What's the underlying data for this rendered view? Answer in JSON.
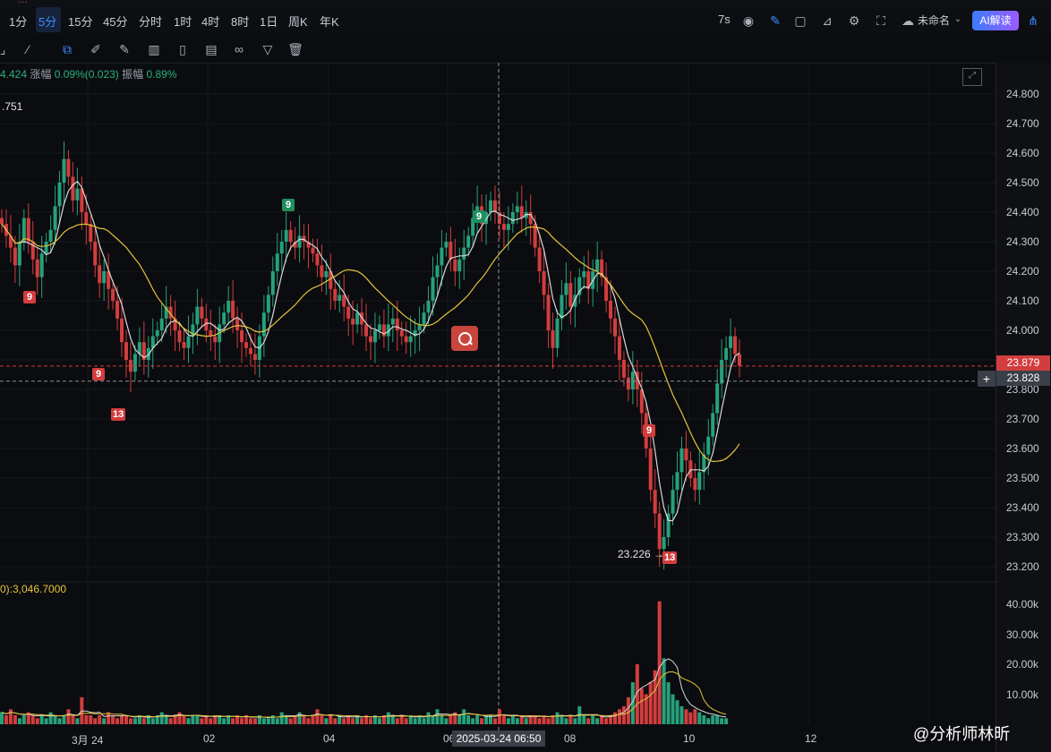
{
  "timeframes": [
    "1分",
    "5分",
    "15分",
    "45分",
    "分时",
    "1时",
    "4时",
    "8时",
    "1日",
    "周K",
    "年K"
  ],
  "active_timeframe": "5分",
  "toolbar_right": {
    "interval": "7s",
    "layout_name": "未命名",
    "ai_label": "AI解读"
  },
  "info_line": {
    "price": "4.424",
    "change_label": "涨幅",
    "change": "0.09%(0.023)",
    "amp_label": "振幅",
    "amplitude": "0.89%"
  },
  "ma_value": ".751",
  "volume_label": "0):3,046.7000",
  "y_axis": [
    "24.800",
    "24.700",
    "24.600",
    "24.500",
    "24.400",
    "24.300",
    "24.200",
    "24.100",
    "24.000",
    "23.900",
    "23.800",
    "23.700",
    "23.600",
    "23.500",
    "23.400",
    "23.300",
    "23.200"
  ],
  "vol_axis": [
    "40.00k",
    "30.00k",
    "20.00k",
    "10.00k"
  ],
  "last_price": "23.879",
  "crosshair_price": "23.828",
  "x_axis": [
    "3月 24",
    "02",
    "04",
    "06",
    "08",
    "10",
    "12"
  ],
  "crosshair_time": "2025-03-24 06:50",
  "low_label": "23.226 →",
  "markers": [
    "9",
    "9",
    "13",
    "9",
    "9",
    "9",
    "13"
  ],
  "watermark": "@分析师林昕",
  "colors": {
    "up": "#26a17b",
    "down": "#d23d3d",
    "ma_fast": "#d8d8d8",
    "ma_slow": "#e3c43a",
    "accent": "#3c8cff",
    "last_price_bg": "#d23d3d"
  },
  "chart_data": {
    "type": "candlestick",
    "ylim": [
      23.2,
      24.8
    ],
    "closes": [
      24.36,
      24.32,
      24.28,
      24.22,
      24.3,
      24.38,
      24.3,
      24.24,
      24.18,
      24.26,
      24.3,
      24.34,
      24.42,
      24.5,
      24.58,
      24.52,
      24.44,
      24.48,
      24.4,
      24.36,
      24.3,
      24.22,
      24.16,
      24.2,
      24.14,
      24.1,
      24.04,
      23.96,
      23.9,
      23.86,
      23.92,
      23.96,
      23.9,
      23.94,
      23.98,
      24.0,
      24.04,
      24.08,
      24.04,
      24.0,
      23.96,
      23.94,
      23.98,
      24.02,
      24.08,
      24.04,
      24.0,
      23.98,
      23.96,
      24.02,
      24.06,
      24.1,
      24.04,
      24.0,
      23.96,
      23.94,
      23.92,
      23.9,
      23.98,
      24.06,
      24.12,
      24.2,
      24.26,
      24.3,
      24.34,
      24.3,
      24.28,
      24.32,
      24.3,
      24.28,
      24.26,
      24.22,
      24.18,
      24.2,
      24.14,
      24.1,
      24.12,
      24.08,
      24.04,
      24.02,
      24.06,
      24.02,
      23.98,
      23.96,
      24.0,
      24.02,
      23.98,
      24.02,
      24.04,
      24.0,
      23.98,
      23.96,
      23.98,
      24.0,
      24.02,
      24.06,
      24.1,
      24.18,
      24.22,
      24.28,
      24.3,
      24.24,
      24.2,
      24.24,
      24.28,
      24.32,
      24.38,
      24.42,
      24.36,
      24.4,
      24.44,
      24.4,
      24.36,
      24.34,
      24.36,
      24.4,
      24.42,
      24.38,
      24.4,
      24.36,
      24.28,
      24.2,
      24.12,
      24.0,
      23.94,
      24.04,
      24.12,
      24.16,
      24.08,
      24.12,
      24.18,
      24.2,
      24.14,
      24.2,
      24.24,
      24.18,
      24.1,
      24.04,
      23.98,
      23.9,
      23.84,
      23.8,
      23.86,
      23.8,
      23.72,
      23.6,
      23.46,
      23.38,
      23.26,
      23.3,
      23.38,
      23.46,
      23.52,
      23.6,
      23.56,
      23.5,
      23.46,
      23.52,
      23.58,
      23.64,
      23.72,
      23.82,
      23.9,
      23.94,
      23.98,
      23.92,
      23.88
    ],
    "volumes": [
      4,
      3,
      5,
      3,
      2,
      3,
      4,
      3,
      2,
      3,
      2,
      4,
      3,
      2,
      3,
      5,
      3,
      2,
      9,
      3,
      3,
      2,
      3,
      2,
      4,
      3,
      2,
      3,
      3,
      2,
      2,
      3,
      2,
      3,
      2,
      3,
      4,
      3,
      2,
      3,
      4,
      3,
      2,
      3,
      3,
      2,
      3,
      2,
      3,
      3,
      2,
      3,
      2,
      3,
      2,
      3,
      2,
      2,
      3,
      2,
      2,
      3,
      2,
      4,
      3,
      2,
      3,
      4,
      3,
      2,
      3,
      5,
      3,
      2,
      3,
      2,
      3,
      2,
      3,
      2,
      3,
      2,
      3,
      2,
      3,
      2,
      3,
      4,
      3,
      2,
      3,
      2,
      3,
      2,
      3,
      2,
      4,
      3,
      5,
      3,
      2,
      3,
      4,
      3,
      5,
      3,
      2,
      3,
      2,
      3,
      3,
      2,
      5,
      3,
      2,
      3,
      2,
      3,
      2,
      3,
      3,
      2,
      3,
      2,
      3,
      4,
      3,
      2,
      3,
      2,
      6,
      3,
      2,
      3,
      2,
      3,
      2,
      3,
      4,
      5,
      6,
      9,
      14,
      20,
      12,
      10,
      14,
      18,
      41,
      22,
      14,
      10,
      8,
      6,
      5,
      4,
      5,
      4,
      3,
      2,
      3,
      3,
      2,
      2
    ]
  }
}
